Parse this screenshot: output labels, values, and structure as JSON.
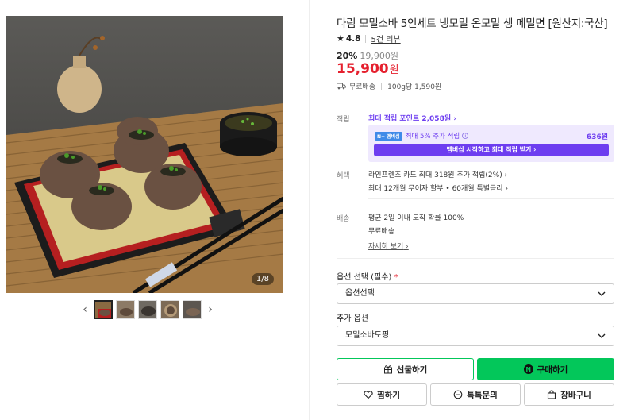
{
  "gallery": {
    "counter_current": "1",
    "counter_total": "8",
    "counter_text": "1/8",
    "prev_icon": "chevron-left-icon",
    "next_icon": "chevron-right-icon",
    "thumbnails_count": 5
  },
  "product": {
    "title": "다림 모밀소바 5인세트 냉모밀 온모밀 생 메밀면 [원산지:국산]",
    "rating": "4.8",
    "reviews": "5건 리뷰",
    "discount": "20%",
    "original_price": "19,900원",
    "price": "15,900",
    "price_unit": "원",
    "shipping": "무료배송",
    "unit_price": "100g당 1,590원"
  },
  "benefits": {
    "points_label": "적립",
    "points_link": "최대 적립 포인트 2,058원",
    "nplus_badge": "N+ 멤버십",
    "nplus_text": "최대 5% 추가 적립",
    "nplus_amount": "636원",
    "nplus_button": "멤버십 시작하고 최대 적립 받기",
    "perks_label": "혜택",
    "perk1": "라인프렌즈 카드 최대 318원 추가 적립(2%)",
    "perk2": "최대 12개월 무이자 할부 • 60개월 특별금리",
    "delivery_label": "배송",
    "delivery1": "평균 2일 이내 도착 확률 100%",
    "delivery2": "무료배송",
    "delivery_more": "자세히 보기"
  },
  "options": {
    "required_title": "옵션 선택 (필수)",
    "required_mark": "*",
    "required_value": "옵션선택",
    "extra_title": "추가 옵션",
    "extra_value": "모밀소바토핑"
  },
  "actions": {
    "gift": "선물하기",
    "buy": "구매하기",
    "buy_badge": "N",
    "wish": "찜하기",
    "talk": "톡톡문의",
    "cart": "장바구니"
  },
  "colors": {
    "naver_green": "#03c75a",
    "price_red": "#e5202e",
    "membership_purple": "#6d3df0"
  }
}
